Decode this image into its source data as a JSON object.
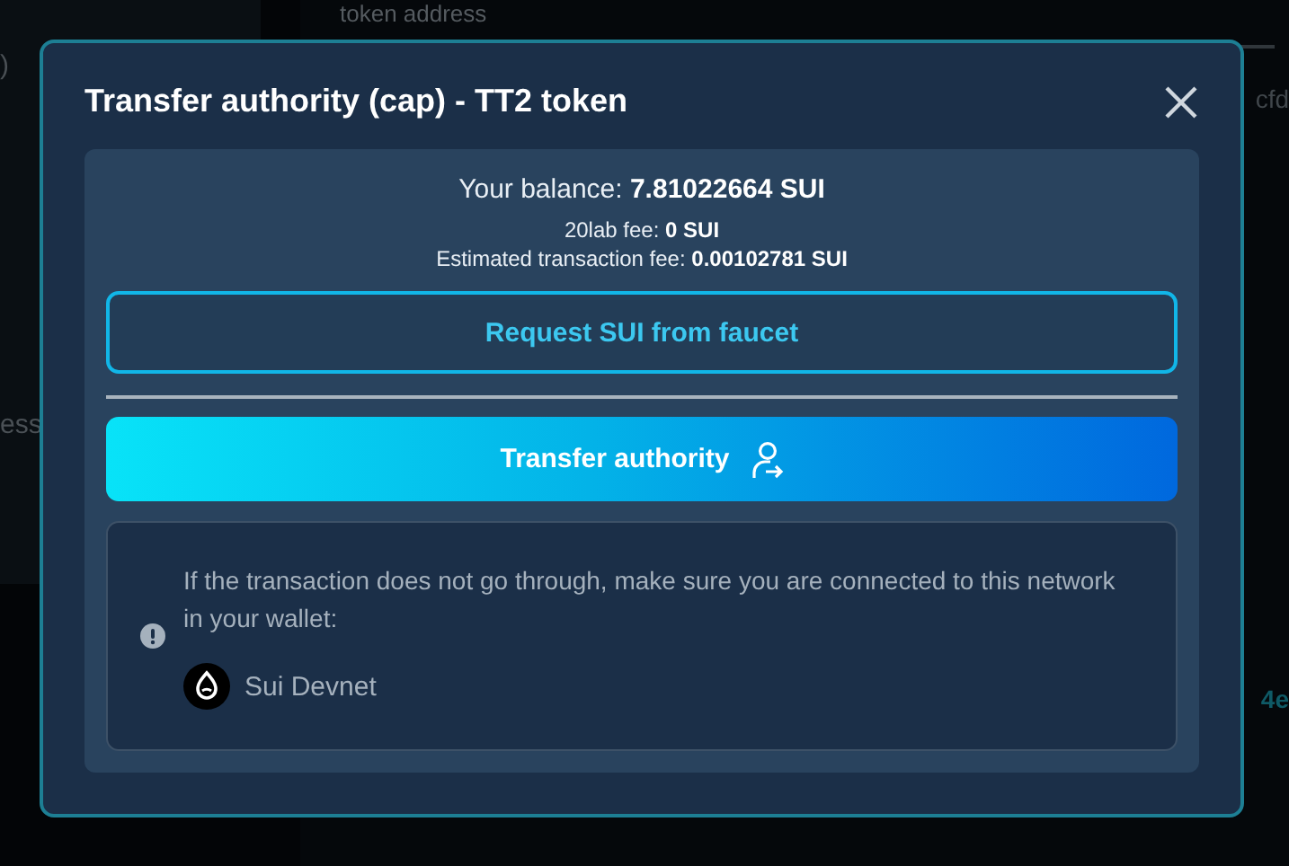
{
  "background": {
    "left_panel": {
      "texts": [
        ")",
        "ess"
      ]
    },
    "main": {
      "field_label": "token address",
      "texts": [
        "cfd",
        "4e"
      ]
    }
  },
  "dialog": {
    "title": "Transfer authority (cap) - TT2 token",
    "balance": {
      "label": "Your balance:",
      "value": "7.81022664 SUI"
    },
    "fees": [
      {
        "label": "20lab fee:",
        "value": "0 SUI"
      },
      {
        "label": "Estimated transaction fee:",
        "value": "0.00102781 SUI"
      }
    ],
    "faucet_button": "Request SUI from faucet",
    "transfer_button": "Transfer authority",
    "notice": {
      "message": "If the transaction does not go through, make sure you are connected to this network in your wallet:",
      "network": "Sui Devnet"
    }
  }
}
